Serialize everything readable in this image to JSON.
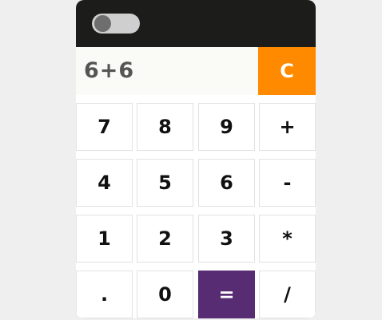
{
  "display": {
    "expression": "6+6"
  },
  "clear_label": "C",
  "theme_toggle": {
    "state": "off"
  },
  "keys": {
    "row1": [
      "7",
      "8",
      "9",
      "+"
    ],
    "row2": [
      "4",
      "5",
      "6",
      "-"
    ],
    "row3": [
      "1",
      "2",
      "3",
      "*"
    ],
    "row4": [
      ".",
      "0",
      "=",
      "/"
    ]
  },
  "colors": {
    "header": "#1c1c1a",
    "clear_button": "#ff8a00",
    "equals_button": "#572c72",
    "background": "#efefef"
  }
}
